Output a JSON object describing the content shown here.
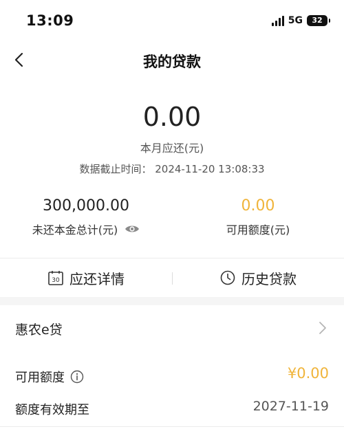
{
  "status_bar": {
    "time": "13:09",
    "network": "5G",
    "battery": "32"
  },
  "nav": {
    "title": "我的贷款"
  },
  "summary": {
    "amount": "0.00",
    "amount_label": "本月应还(元)",
    "cutoff_label": "数据截止时间：",
    "cutoff_time": "2024-11-20 13:08:33"
  },
  "stats": {
    "principal_value": "300,000.00",
    "principal_label": "未还本金总计(元)",
    "available_value": "0.00",
    "available_label": "可用额度(元)"
  },
  "tabs": [
    {
      "label": "应还详情",
      "icon": "calendar-icon",
      "icon_text": "30"
    },
    {
      "label": "历史贷款",
      "icon": "clock-icon"
    }
  ],
  "product": {
    "name": "惠农e贷"
  },
  "details": {
    "available_label": "可用额度",
    "available_value": "¥0.00",
    "expiry_label": "额度有效期至",
    "expiry_value": "2027-11-19"
  },
  "colors": {
    "accent_gold": "#f0b43a",
    "text_dark": "#222222",
    "text_gray": "#555555"
  }
}
